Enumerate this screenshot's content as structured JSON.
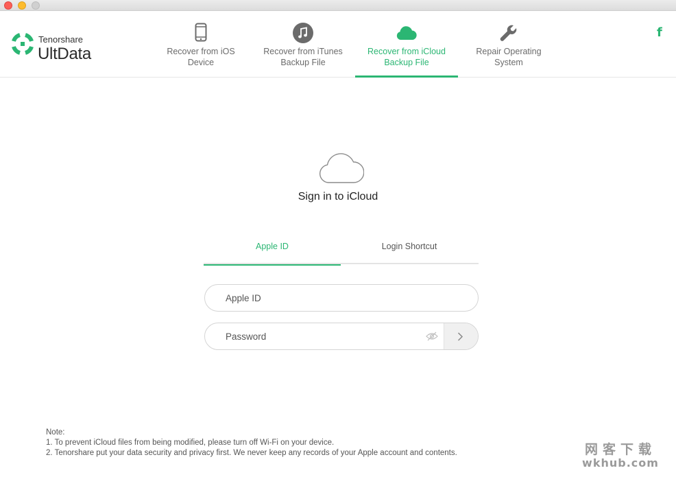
{
  "brand": {
    "company": "Tenorshare",
    "product": "UltData",
    "accent": "#2bb673"
  },
  "nav": {
    "tabs": [
      {
        "label": "Recover from iOS\nDevice",
        "icon": "phone-icon",
        "active": false
      },
      {
        "label": "Recover from iTunes\nBackup File",
        "icon": "music-note-icon",
        "active": false
      },
      {
        "label": "Recover from iCloud\nBackup File",
        "icon": "cloud-icon",
        "active": true
      },
      {
        "label": "Repair Operating\nSystem",
        "icon": "wrench-icon",
        "active": false
      }
    ],
    "social": "f"
  },
  "signin": {
    "title": "Sign in to iCloud",
    "tabs": {
      "apple_id": "Apple ID",
      "login_shortcut": "Login Shortcut"
    },
    "apple_id_placeholder": "Apple ID",
    "password_placeholder": "Password"
  },
  "note": {
    "heading": "Note:",
    "line1": "1. To prevent iCloud files from being modified, please turn off  Wi-Fi on your device.",
    "line2": "2. Tenorshare put your data security and privacy first. We never keep any records of your Apple account and contents."
  },
  "watermark": {
    "line1": "网客下载",
    "line2": "wkhub.com"
  }
}
